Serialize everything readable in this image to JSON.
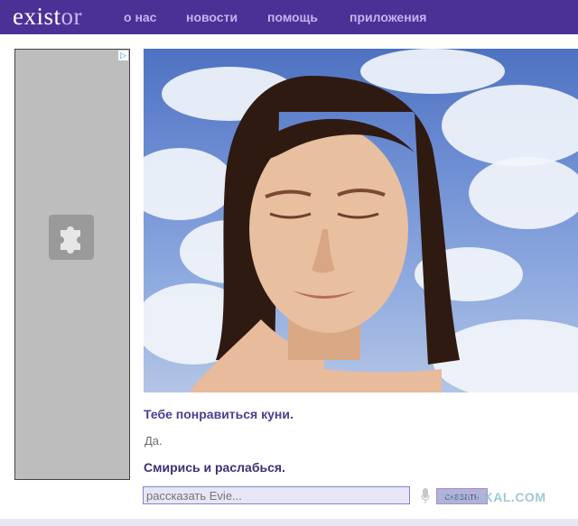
{
  "header": {
    "logo_part1": "exist",
    "logo_part2": "or",
    "nav": [
      "о нас",
      "новости",
      "помощь",
      "приложения"
    ]
  },
  "ad": {
    "choice_icon": "adchoices-icon",
    "plugin_icon": "plugin-puzzle-icon"
  },
  "chat": {
    "bot_message": "Тебе понравиться куни.",
    "user_reply": "Да.",
    "bot_reply": "Смирись и раслабься.",
    "input_placeholder": "рассказать Evie...",
    "say_label": "сказать"
  },
  "watermark": "YAPLAKAL.COM",
  "colors": {
    "brand": "#4a3196",
    "nav_text": "#c3b3ee",
    "accent_text": "#4a3f8f"
  }
}
